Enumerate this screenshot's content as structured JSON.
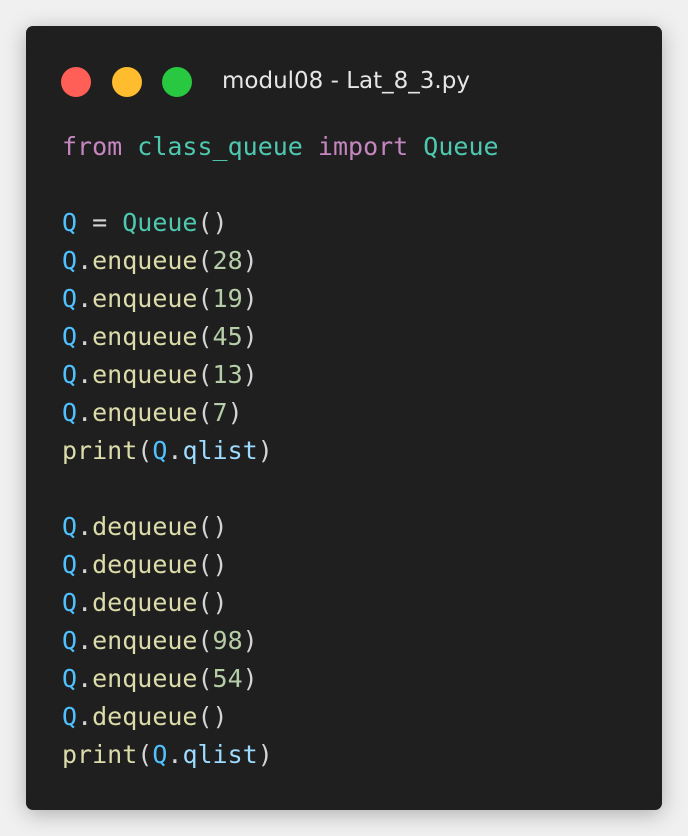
{
  "window": {
    "title": "modul08 - Lat_8_3.py",
    "controls": [
      {
        "name": "close",
        "color": "#ff5f57"
      },
      {
        "name": "minimize",
        "color": "#febc2e"
      },
      {
        "name": "maximize",
        "color": "#28c840"
      }
    ]
  },
  "colors": {
    "keyword": "#c586c0",
    "class": "#4ec9b0",
    "variable": "#4fc1ff",
    "property": "#9cdcfe",
    "function": "#dcdcaa",
    "number": "#b5cea8",
    "plain": "#d4d4d4"
  },
  "code": {
    "lines": [
      [
        {
          "t": "from",
          "c": "keyword"
        },
        {
          "t": " ",
          "c": "plain"
        },
        {
          "t": "class_queue",
          "c": "class"
        },
        {
          "t": " ",
          "c": "plain"
        },
        {
          "t": "import",
          "c": "keyword"
        },
        {
          "t": " ",
          "c": "plain"
        },
        {
          "t": "Queue",
          "c": "class"
        }
      ],
      [],
      [
        {
          "t": "Q",
          "c": "variable"
        },
        {
          "t": " = ",
          "c": "plain"
        },
        {
          "t": "Queue",
          "c": "class"
        },
        {
          "t": "()",
          "c": "plain"
        }
      ],
      [
        {
          "t": "Q",
          "c": "variable"
        },
        {
          "t": ".",
          "c": "plain"
        },
        {
          "t": "enqueue",
          "c": "function"
        },
        {
          "t": "(",
          "c": "plain"
        },
        {
          "t": "28",
          "c": "number"
        },
        {
          "t": ")",
          "c": "plain"
        }
      ],
      [
        {
          "t": "Q",
          "c": "variable"
        },
        {
          "t": ".",
          "c": "plain"
        },
        {
          "t": "enqueue",
          "c": "function"
        },
        {
          "t": "(",
          "c": "plain"
        },
        {
          "t": "19",
          "c": "number"
        },
        {
          "t": ")",
          "c": "plain"
        }
      ],
      [
        {
          "t": "Q",
          "c": "variable"
        },
        {
          "t": ".",
          "c": "plain"
        },
        {
          "t": "enqueue",
          "c": "function"
        },
        {
          "t": "(",
          "c": "plain"
        },
        {
          "t": "45",
          "c": "number"
        },
        {
          "t": ")",
          "c": "plain"
        }
      ],
      [
        {
          "t": "Q",
          "c": "variable"
        },
        {
          "t": ".",
          "c": "plain"
        },
        {
          "t": "enqueue",
          "c": "function"
        },
        {
          "t": "(",
          "c": "plain"
        },
        {
          "t": "13",
          "c": "number"
        },
        {
          "t": ")",
          "c": "plain"
        }
      ],
      [
        {
          "t": "Q",
          "c": "variable"
        },
        {
          "t": ".",
          "c": "plain"
        },
        {
          "t": "enqueue",
          "c": "function"
        },
        {
          "t": "(",
          "c": "plain"
        },
        {
          "t": "7",
          "c": "number"
        },
        {
          "t": ")",
          "c": "plain"
        }
      ],
      [
        {
          "t": "print",
          "c": "function"
        },
        {
          "t": "(",
          "c": "plain"
        },
        {
          "t": "Q",
          "c": "variable"
        },
        {
          "t": ".",
          "c": "plain"
        },
        {
          "t": "qlist",
          "c": "property"
        },
        {
          "t": ")",
          "c": "plain"
        }
      ],
      [],
      [
        {
          "t": "Q",
          "c": "variable"
        },
        {
          "t": ".",
          "c": "plain"
        },
        {
          "t": "dequeue",
          "c": "function"
        },
        {
          "t": "()",
          "c": "plain"
        }
      ],
      [
        {
          "t": "Q",
          "c": "variable"
        },
        {
          "t": ".",
          "c": "plain"
        },
        {
          "t": "dequeue",
          "c": "function"
        },
        {
          "t": "()",
          "c": "plain"
        }
      ],
      [
        {
          "t": "Q",
          "c": "variable"
        },
        {
          "t": ".",
          "c": "plain"
        },
        {
          "t": "dequeue",
          "c": "function"
        },
        {
          "t": "()",
          "c": "plain"
        }
      ],
      [
        {
          "t": "Q",
          "c": "variable"
        },
        {
          "t": ".",
          "c": "plain"
        },
        {
          "t": "enqueue",
          "c": "function"
        },
        {
          "t": "(",
          "c": "plain"
        },
        {
          "t": "98",
          "c": "number"
        },
        {
          "t": ")",
          "c": "plain"
        }
      ],
      [
        {
          "t": "Q",
          "c": "variable"
        },
        {
          "t": ".",
          "c": "plain"
        },
        {
          "t": "enqueue",
          "c": "function"
        },
        {
          "t": "(",
          "c": "plain"
        },
        {
          "t": "54",
          "c": "number"
        },
        {
          "t": ")",
          "c": "plain"
        }
      ],
      [
        {
          "t": "Q",
          "c": "variable"
        },
        {
          "t": ".",
          "c": "plain"
        },
        {
          "t": "dequeue",
          "c": "function"
        },
        {
          "t": "()",
          "c": "plain"
        }
      ],
      [
        {
          "t": "print",
          "c": "function"
        },
        {
          "t": "(",
          "c": "plain"
        },
        {
          "t": "Q",
          "c": "variable"
        },
        {
          "t": ".",
          "c": "plain"
        },
        {
          "t": "qlist",
          "c": "property"
        },
        {
          "t": ")",
          "c": "plain"
        }
      ]
    ]
  }
}
